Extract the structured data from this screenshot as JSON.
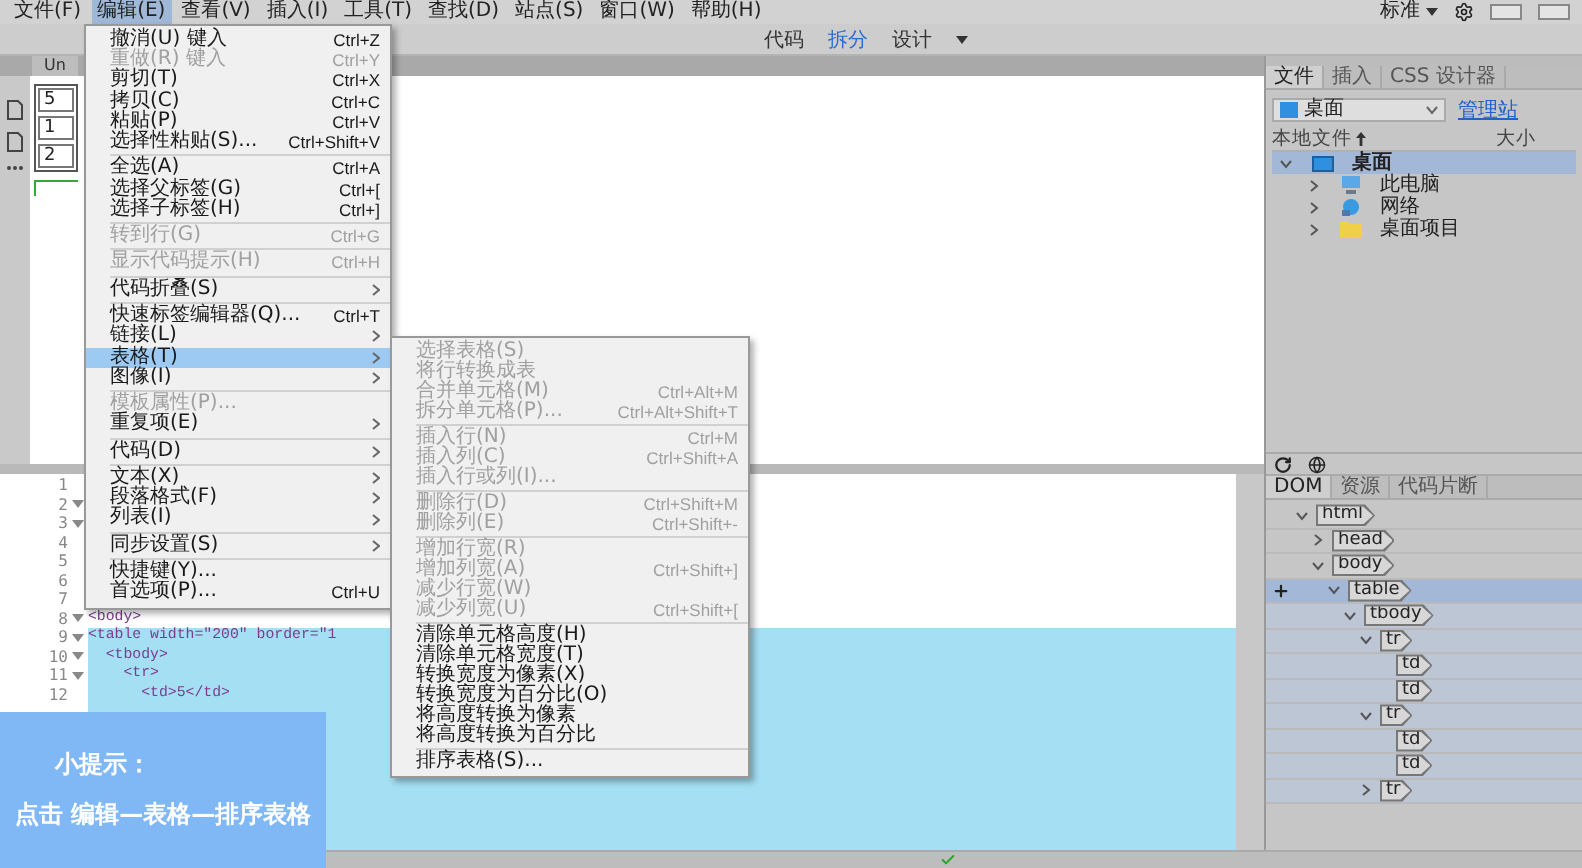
{
  "menubar": {
    "items": [
      {
        "label": "文件(F)",
        "selected": false
      },
      {
        "label": "编辑(E)",
        "selected": true
      },
      {
        "label": "查看(V)",
        "selected": false
      },
      {
        "label": "插入(I)",
        "selected": false
      },
      {
        "label": "工具(T)",
        "selected": false
      },
      {
        "label": "查找(D)",
        "selected": false
      },
      {
        "label": "站点(S)",
        "selected": false
      },
      {
        "label": "窗口(W)",
        "selected": false
      },
      {
        "label": "帮助(H)",
        "selected": false
      }
    ],
    "workspace": "标准"
  },
  "view_switcher": [
    {
      "label": "代码",
      "selected": false
    },
    {
      "label": "拆分",
      "selected": true
    },
    {
      "label": "设计",
      "selected": false
    }
  ],
  "document_tab": "Un",
  "design_table": [
    "5",
    "1",
    "2"
  ],
  "code_lines": [
    {
      "number": "1",
      "fold": false,
      "selected": false
    },
    {
      "number": "2",
      "fold": true,
      "selected": false
    },
    {
      "number": "3",
      "fold": true,
      "selected": false
    },
    {
      "number": "4",
      "fold": false,
      "selected": false
    },
    {
      "number": "5",
      "fold": false,
      "selected": false
    },
    {
      "number": "6",
      "fold": false,
      "selected": false
    },
    {
      "number": "7",
      "fold": false,
      "selected": false
    },
    {
      "number": "8",
      "fold": true,
      "selected": false,
      "text": "<body>"
    },
    {
      "number": "9",
      "fold": true,
      "selected": true,
      "text": "<table width=\"200\" border=\"1"
    },
    {
      "number": "10",
      "fold": true,
      "selected": true,
      "text": "  <tbody>"
    },
    {
      "number": "11",
      "fold": true,
      "selected": true,
      "text": "    <tr>"
    },
    {
      "number": "12",
      "fold": false,
      "selected": true,
      "text": "      <td>5</td>"
    }
  ],
  "edit_menu": [
    {
      "kind": "item",
      "label": "撤消(U) 键入",
      "shortcut": "Ctrl+Z",
      "disabled": false,
      "submenu": false,
      "selected": false
    },
    {
      "kind": "item",
      "label": "重做(R) 键入",
      "shortcut": "Ctrl+Y",
      "disabled": true,
      "submenu": false,
      "selected": false
    },
    {
      "kind": "item",
      "label": "剪切(T)",
      "shortcut": "Ctrl+X",
      "disabled": false,
      "submenu": false,
      "selected": false
    },
    {
      "kind": "item",
      "label": "拷贝(C)",
      "shortcut": "Ctrl+C",
      "disabled": false,
      "submenu": false,
      "selected": false
    },
    {
      "kind": "item",
      "label": "粘贴(P)",
      "shortcut": "Ctrl+V",
      "disabled": false,
      "submenu": false,
      "selected": false
    },
    {
      "kind": "item",
      "label": "选择性粘贴(S)...",
      "shortcut": "Ctrl+Shift+V",
      "disabled": false,
      "submenu": false,
      "selected": false
    },
    {
      "kind": "separator"
    },
    {
      "kind": "item",
      "label": "全选(A)",
      "shortcut": "Ctrl+A",
      "disabled": false,
      "submenu": false,
      "selected": false
    },
    {
      "kind": "item",
      "label": "选择父标签(G)",
      "shortcut": "Ctrl+[",
      "disabled": false,
      "submenu": false,
      "selected": false
    },
    {
      "kind": "item",
      "label": "选择子标签(H)",
      "shortcut": "Ctrl+]",
      "disabled": false,
      "submenu": false,
      "selected": false
    },
    {
      "kind": "separator"
    },
    {
      "kind": "item",
      "label": "转到行(G)",
      "shortcut": "Ctrl+G",
      "disabled": true,
      "submenu": false,
      "selected": false
    },
    {
      "kind": "separator"
    },
    {
      "kind": "item",
      "label": "显示代码提示(H)",
      "shortcut": "Ctrl+H",
      "disabled": true,
      "submenu": false,
      "selected": false
    },
    {
      "kind": "separator"
    },
    {
      "kind": "item",
      "label": "代码折叠(S)",
      "disabled": false,
      "submenu": true,
      "selected": false
    },
    {
      "kind": "separator"
    },
    {
      "kind": "item",
      "label": "快速标签编辑器(Q)...",
      "shortcut": "Ctrl+T",
      "disabled": false,
      "submenu": false,
      "selected": false
    },
    {
      "kind": "item",
      "label": "链接(L)",
      "disabled": false,
      "submenu": true,
      "selected": false
    },
    {
      "kind": "item",
      "label": "表格(T)",
      "disabled": false,
      "submenu": true,
      "selected": true
    },
    {
      "kind": "item",
      "label": "图像(I)",
      "disabled": false,
      "submenu": true,
      "selected": false
    },
    {
      "kind": "separator"
    },
    {
      "kind": "item",
      "label": "模板属性(P)...",
      "disabled": true,
      "submenu": false,
      "selected": false
    },
    {
      "kind": "item",
      "label": "重复项(E)",
      "disabled": false,
      "submenu": true,
      "selected": false
    },
    {
      "kind": "separator"
    },
    {
      "kind": "item",
      "label": "代码(D)",
      "disabled": false,
      "submenu": true,
      "selected": false
    },
    {
      "kind": "separator"
    },
    {
      "kind": "item",
      "label": "文本(X)",
      "disabled": false,
      "submenu": true,
      "selected": false
    },
    {
      "kind": "item",
      "label": "段落格式(F)",
      "disabled": false,
      "submenu": true,
      "selected": false
    },
    {
      "kind": "item",
      "label": "列表(I)",
      "disabled": false,
      "submenu": true,
      "selected": false
    },
    {
      "kind": "separator"
    },
    {
      "kind": "item",
      "label": "同步设置(S)",
      "disabled": false,
      "submenu": true,
      "selected": false
    },
    {
      "kind": "separator"
    },
    {
      "kind": "item",
      "label": "快捷键(Y)...",
      "disabled": false,
      "submenu": false,
      "selected": false
    },
    {
      "kind": "item",
      "label": "首选项(P)...",
      "shortcut": "Ctrl+U",
      "disabled": false,
      "submenu": false,
      "selected": false
    }
  ],
  "table_submenu": [
    {
      "kind": "item",
      "label": "选择表格(S)",
      "disabled": true
    },
    {
      "kind": "item",
      "label": "将行转换成表",
      "disabled": true
    },
    {
      "kind": "item",
      "label": "合并单元格(M)",
      "shortcut": "Ctrl+Alt+M",
      "disabled": true
    },
    {
      "kind": "item",
      "label": "拆分单元格(P)...",
      "shortcut": "Ctrl+Alt+Shift+T",
      "disabled": true
    },
    {
      "kind": "separator"
    },
    {
      "kind": "item",
      "label": "插入行(N)",
      "shortcut": "Ctrl+M",
      "disabled": true
    },
    {
      "kind": "item",
      "label": "插入列(C)",
      "shortcut": "Ctrl+Shift+A",
      "disabled": true
    },
    {
      "kind": "item",
      "label": "插入行或列(I)...",
      "disabled": true
    },
    {
      "kind": "separator"
    },
    {
      "kind": "item",
      "label": "删除行(D)",
      "shortcut": "Ctrl+Shift+M",
      "disabled": true
    },
    {
      "kind": "item",
      "label": "删除列(E)",
      "shortcut": "Ctrl+Shift+-",
      "disabled": true
    },
    {
      "kind": "separator"
    },
    {
      "kind": "item",
      "label": "增加行宽(R)",
      "disabled": true
    },
    {
      "kind": "item",
      "label": "增加列宽(A)",
      "shortcut": "Ctrl+Shift+]",
      "disabled": true
    },
    {
      "kind": "item",
      "label": "减少行宽(W)",
      "disabled": true
    },
    {
      "kind": "item",
      "label": "减少列宽(U)",
      "shortcut": "Ctrl+Shift+[",
      "disabled": true
    },
    {
      "kind": "separator"
    },
    {
      "kind": "item",
      "label": "清除单元格高度(H)",
      "disabled": false
    },
    {
      "kind": "item",
      "label": "清除单元格宽度(T)",
      "disabled": false
    },
    {
      "kind": "item",
      "label": "转换宽度为像素(X)",
      "disabled": false
    },
    {
      "kind": "item",
      "label": "转换宽度为百分比(O)",
      "disabled": false
    },
    {
      "kind": "item",
      "label": "将高度转换为像素",
      "disabled": false
    },
    {
      "kind": "item",
      "label": "将高度转换为百分比",
      "disabled": false
    },
    {
      "kind": "separator"
    },
    {
      "kind": "item",
      "label": "排序表格(S)...",
      "disabled": false
    }
  ],
  "files_panel": {
    "tabs": [
      {
        "label": "文件",
        "selected": true
      },
      {
        "label": "插入",
        "selected": false
      },
      {
        "label": "CSS 设计器",
        "selected": false
      }
    ],
    "site": "桌面",
    "manage_link": "管理站",
    "columns": [
      "本地文件",
      "大小"
    ],
    "tree": [
      {
        "label": "桌面",
        "kind": "desktop",
        "expanded": true,
        "selected": true,
        "children": [
          {
            "label": "此电脑",
            "kind": "computer",
            "expanded": false,
            "selected": false
          },
          {
            "label": "网络",
            "kind": "network",
            "expanded": false,
            "selected": false
          },
          {
            "label": "桌面项目",
            "kind": "folder",
            "expanded": false,
            "selected": false
          }
        ]
      }
    ]
  },
  "dom_panel": {
    "tabs": [
      {
        "label": "DOM",
        "selected": true
      },
      {
        "label": "资源",
        "selected": false
      },
      {
        "label": "代码片断",
        "selected": false
      }
    ],
    "tree": [
      {
        "label": "html",
        "expanded": true,
        "selected": false,
        "children": [
          {
            "label": "head",
            "expanded": false,
            "selected": false
          },
          {
            "label": "body",
            "expanded": true,
            "selected": false,
            "children": [
              {
                "label": "table",
                "expanded": true,
                "selected": true,
                "children": [
                  {
                    "label": "tbody",
                    "expanded": true,
                    "selected": false,
                    "children": [
                      {
                        "label": "tr",
                        "expanded": true,
                        "selected": false,
                        "children": [
                          {
                            "label": "td",
                            "selected": false
                          },
                          {
                            "label": "td",
                            "selected": false
                          }
                        ]
                      },
                      {
                        "label": "tr",
                        "expanded": true,
                        "selected": false,
                        "children": [
                          {
                            "label": "td",
                            "selected": false
                          },
                          {
                            "label": "td",
                            "selected": false
                          }
                        ]
                      },
                      {
                        "label": "tr",
                        "expanded": false,
                        "selected": false
                      }
                    ]
                  }
                ]
              }
            ]
          }
        ]
      }
    ]
  },
  "tip": {
    "title": "小提示：",
    "text": "点击 编辑—表格—排序表格"
  }
}
